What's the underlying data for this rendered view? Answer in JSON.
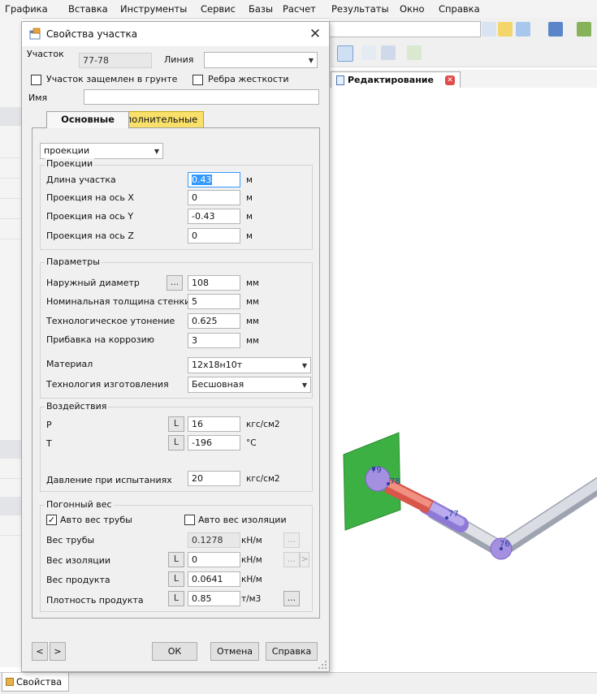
{
  "menu": [
    "Графика",
    "Вставка",
    "Инструменты",
    "Сервис",
    "Базы",
    "Расчет",
    "Результаты",
    "Окно",
    "Справка"
  ],
  "background": {
    "editor_tab_label": "Редактирование",
    "bottom_tab_label": "Свойства",
    "node_labels": [
      "79",
      "78",
      "77",
      "76"
    ],
    "colors": {
      "support": "#3cb043",
      "elbow": "#a48fe0",
      "segment_red": "#e8705a",
      "pipe": "#cfd2db"
    }
  },
  "dialog": {
    "title": "Свойства участка",
    "segment_label": "Участок",
    "segment_value": "77-78",
    "line_label": "Линия",
    "line_value": "",
    "buried_label": "Участок защемлен в грунте",
    "ribs_label": "Ребра жесткости",
    "name_label": "Имя",
    "name_value": "",
    "tabs": {
      "basic": "Основные",
      "extra": "Дополнительные"
    },
    "mode_value": "проекции",
    "projections": {
      "group": "Проекции",
      "rows": [
        {
          "label": "Длина участка",
          "value": "0.43",
          "unit": "м"
        },
        {
          "label": "Проекция на ось X",
          "value": "0",
          "unit": "м"
        },
        {
          "label": "Проекция на ось Y",
          "value": "-0.43",
          "unit": "м"
        },
        {
          "label": "Проекция на ось Z",
          "value": "0",
          "unit": "м"
        }
      ]
    },
    "params": {
      "group": "Параметры",
      "rows": [
        {
          "label": "Наружный диаметр",
          "value": "108",
          "unit": "мм"
        },
        {
          "label": "Номинальная толщина стенки",
          "value": "5",
          "unit": "мм"
        },
        {
          "label": "Технологическое утонение",
          "value": "0.625",
          "unit": "мм"
        },
        {
          "label": "Прибавка на коррозию",
          "value": "3",
          "unit": "мм"
        }
      ],
      "material_label": "Материал",
      "material_value": "12х18н10т",
      "tech_label": "Технология изготовления",
      "tech_value": "Бесшовная"
    },
    "impacts": {
      "group": "Воздействия",
      "p_label": "P",
      "p_value": "16",
      "p_unit": "кгс/см2",
      "t_label": "T",
      "t_value": "-196",
      "t_unit": "°С",
      "test_label": "Давление при испытаниях",
      "test_value": "20",
      "test_unit": "кгс/см2"
    },
    "weight": {
      "group": "Погонный вес",
      "auto_pipe_label": "Авто вес трубы",
      "auto_pipe_checked": true,
      "auto_ins_label": "Авто вес изоляции",
      "auto_ins_checked": false,
      "pipe_label": "Вес трубы",
      "pipe_value": "0.1278",
      "pipe_unit": "кН/м",
      "ins_label": "Вес изоляции",
      "ins_value": "0",
      "ins_unit": "кН/м",
      "prod_label": "Вес продукта",
      "prod_value": "0.0641",
      "prod_unit": "кН/м",
      "dens_label": "Плотность продукта",
      "dens_value": "0.85",
      "dens_unit": "т/м3"
    },
    "small": {
      "l": "L",
      "dots": "...",
      "arrow_right": ">",
      "nav_prev": "<",
      "nav_next": ">"
    },
    "buttons": {
      "ok": "ОК",
      "cancel": "Отмена",
      "help": "Справка"
    }
  }
}
